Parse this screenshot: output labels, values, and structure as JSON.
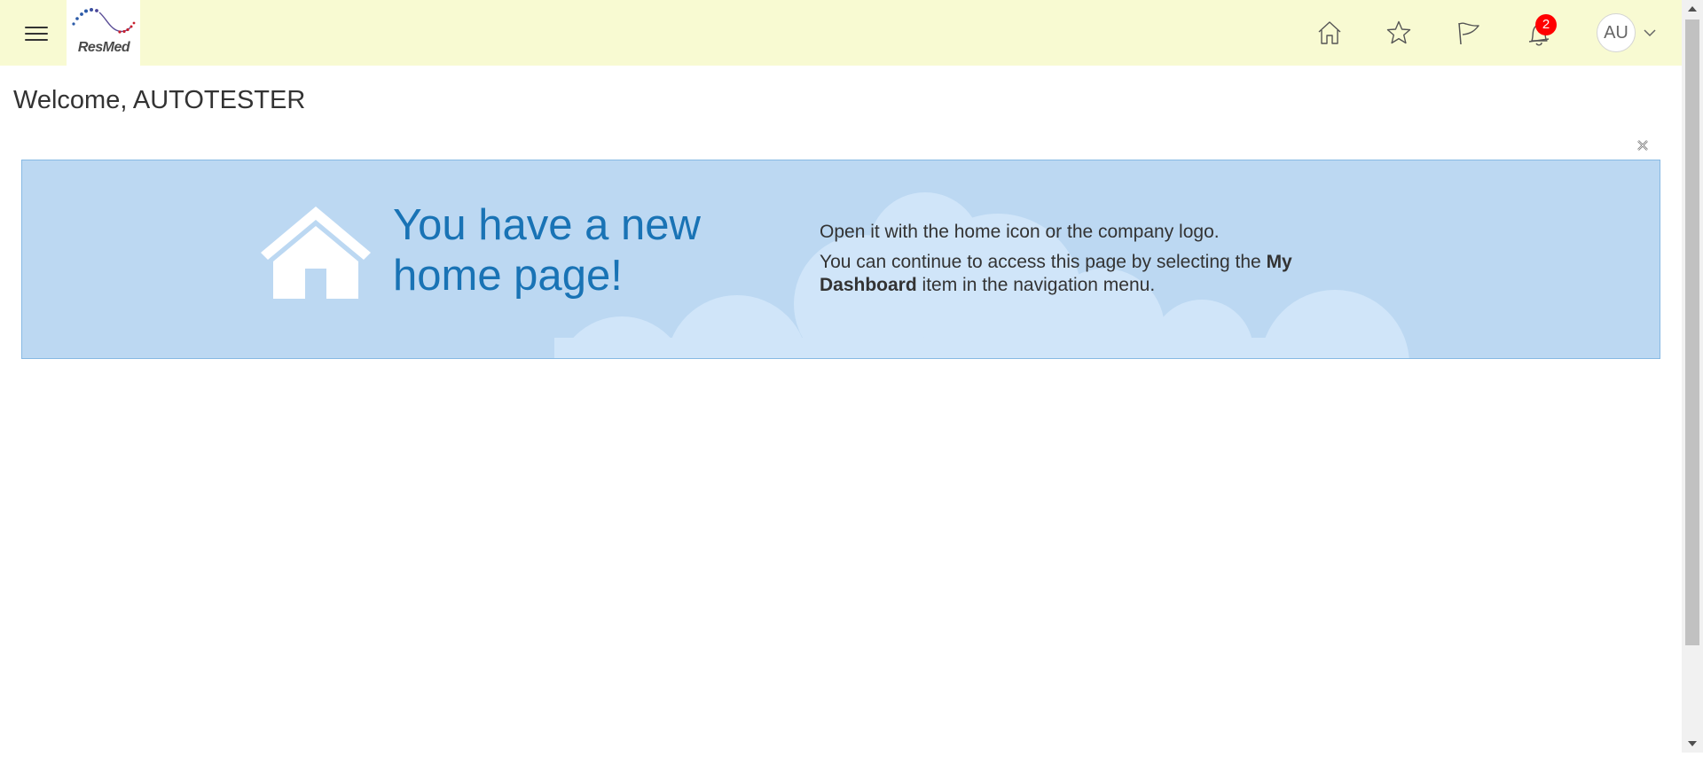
{
  "header": {
    "brand": "ResMed",
    "notifications_count": "2",
    "avatar_initials": "AU"
  },
  "welcome": {
    "text": "Welcome, AUTOTESTER"
  },
  "banner": {
    "headline": "You have a new home page!",
    "line1": "Open it with the home icon or the company logo.",
    "line2_prefix": "You can continue to access this page by selecting the ",
    "line2_bold": "My Dashboard",
    "line2_suffix": " item in the navigation menu."
  },
  "icons": {
    "menu": "hamburger-menu-icon",
    "home": "home-icon",
    "favorites": "star-icon",
    "flag": "flag-icon",
    "notifications": "bell-icon",
    "close": "close-icon",
    "user_menu": "chevron-down-icon"
  },
  "colors": {
    "topbar_bg": "#f8fad2",
    "banner_bg": "#bcd8f2",
    "banner_border": "#87b9e3",
    "headline": "#1973b5",
    "badge": "#ff0000"
  }
}
